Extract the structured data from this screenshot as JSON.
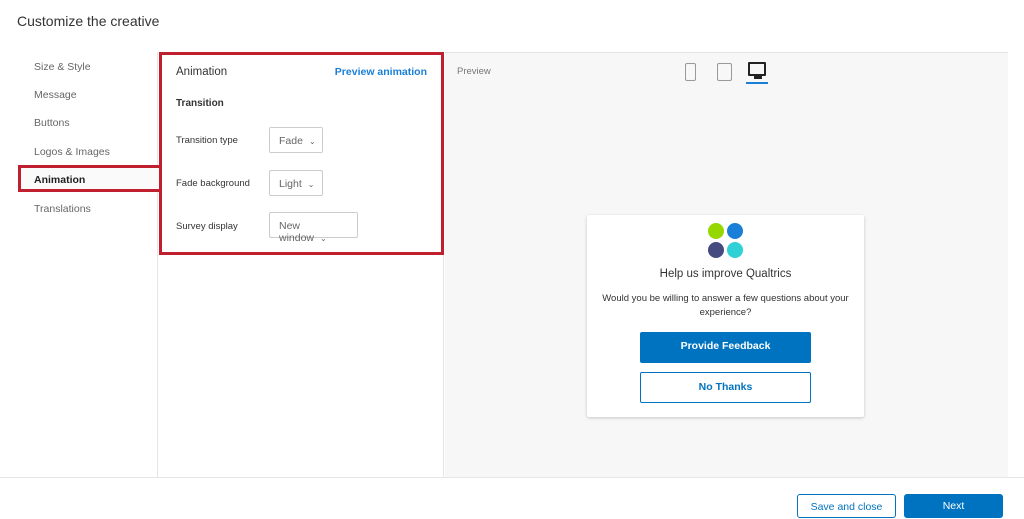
{
  "title": "Customize the creative",
  "nav": {
    "items": [
      "Size & Style",
      "Message",
      "Buttons",
      "Logos & Images",
      "Animation",
      "Translations"
    ],
    "active": "Animation"
  },
  "panel": {
    "heading": "Animation",
    "preview_link": "Preview animation",
    "section": "Transition",
    "fields": [
      {
        "label": "Transition type",
        "value": "Fade"
      },
      {
        "label": "Fade background",
        "value": "Light"
      },
      {
        "label": "Survey display",
        "value": "New window"
      }
    ]
  },
  "preview": {
    "label": "Preview",
    "devices": [
      "phone-icon",
      "tablet-icon",
      "desktop-icon"
    ],
    "selected_device": "desktop",
    "card": {
      "title": "Help us improve Qualtrics",
      "body": "Would you be willing to answer a few questions about your experience?",
      "primary": "Provide Feedback",
      "secondary": "No Thanks",
      "logo_colors": [
        "#97d700",
        "#1a7fd6",
        "#454b81",
        "#2fd1d6"
      ]
    }
  },
  "footer": {
    "save": "Save and close",
    "next": "Next"
  },
  "colors": {
    "accent": "#0073c0",
    "highlight": "#c01f2f"
  }
}
